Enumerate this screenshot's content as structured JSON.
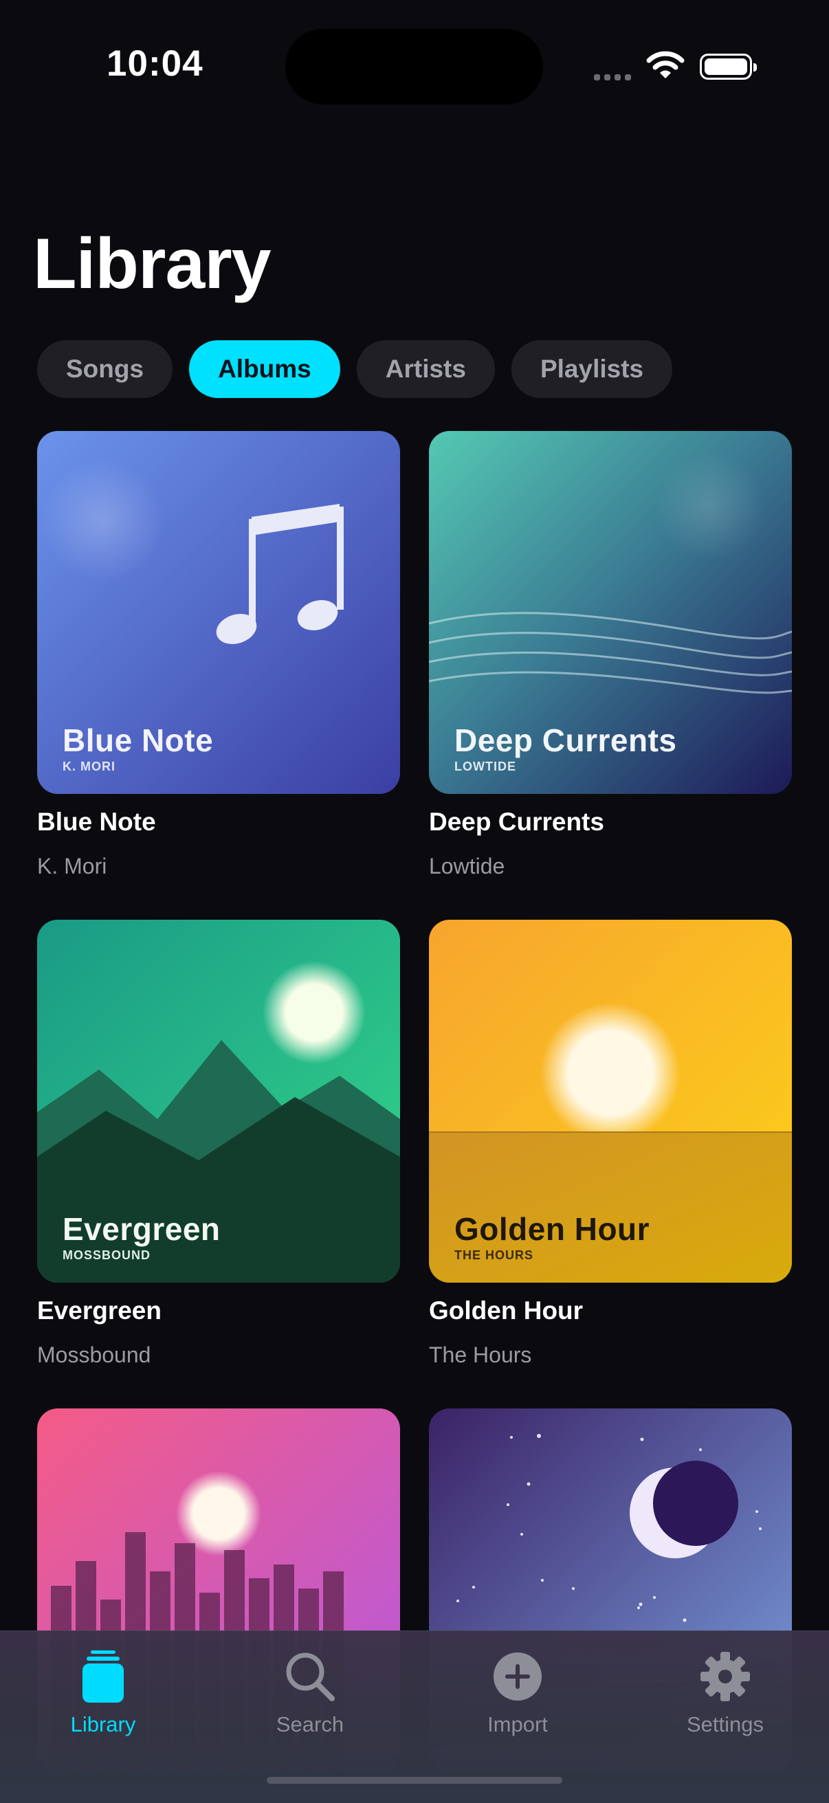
{
  "status": {
    "time": "10:04"
  },
  "header": {
    "title": "Library"
  },
  "filters": [
    {
      "label": "Songs",
      "active": false
    },
    {
      "label": "Albums",
      "active": true
    },
    {
      "label": "Artists",
      "active": false
    },
    {
      "label": "Playlists",
      "active": false
    }
  ],
  "albums": [
    {
      "art_title": "Blue Note",
      "art_sub": "K. MORI",
      "name": "Blue Note",
      "artist": "K. Mori"
    },
    {
      "art_title": "Deep Currents",
      "art_sub": "LOWTIDE",
      "name": "Deep Currents",
      "artist": "Lowtide"
    },
    {
      "art_title": "Evergreen",
      "art_sub": "MOSSBOUND",
      "name": "Evergreen",
      "artist": "Mossbound"
    },
    {
      "art_title": "Golden Hour",
      "art_sub": "THE HOURS",
      "name": "Golden Hour",
      "artist": "The Hours"
    },
    {
      "art_title": "",
      "art_sub": "",
      "name": "",
      "artist": ""
    },
    {
      "art_title": "",
      "art_sub": "",
      "name": "",
      "artist": ""
    }
  ],
  "tabbar": {
    "items": [
      {
        "label": "Library",
        "icon": "library-icon",
        "active": true
      },
      {
        "label": "Search",
        "icon": "search-icon",
        "active": false
      },
      {
        "label": "Import",
        "icon": "plus-circle-icon",
        "active": false
      },
      {
        "label": "Settings",
        "icon": "gear-icon",
        "active": false
      }
    ]
  },
  "colors": {
    "accent": "#00e0ff",
    "background": "#0b0b0f"
  }
}
